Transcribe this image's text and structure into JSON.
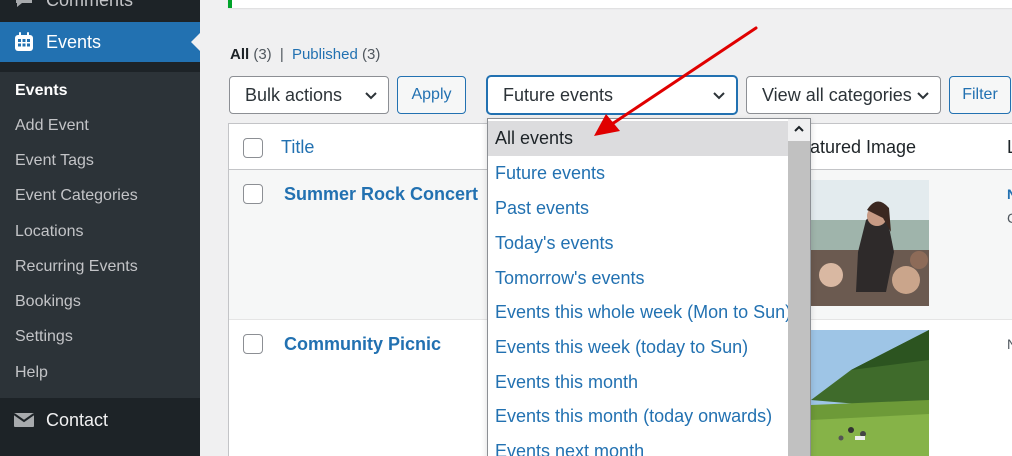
{
  "sidebar": {
    "comments_label": "Comments",
    "events_label": "Events",
    "submenu": [
      {
        "label": "Events",
        "current": true
      },
      {
        "label": "Add Event"
      },
      {
        "label": "Event Tags"
      },
      {
        "label": "Event Categories"
      },
      {
        "label": "Locations"
      },
      {
        "label": "Recurring Events"
      },
      {
        "label": "Bookings"
      },
      {
        "label": "Settings"
      },
      {
        "label": "Help"
      }
    ],
    "contact_label": "Contact"
  },
  "filters": {
    "all_label": "All",
    "all_count": "(3)",
    "separator": "|",
    "published_label": "Published",
    "published_count": "(3)",
    "bulk_actions": "Bulk actions",
    "apply": "Apply",
    "scope_selected": "Future events",
    "category_selected": "View all categories",
    "filter": "Filter"
  },
  "table": {
    "col_title": "Title",
    "col_featured": "Featured Image",
    "col_l": "L",
    "rows": [
      {
        "title": "Summer Rock Concert",
        "side_n": "N",
        "side_c": "C"
      },
      {
        "title": "Community Picnic",
        "side_n": "",
        "side_c": "N"
      }
    ]
  },
  "dropdown": {
    "options": [
      "All events",
      "Future events",
      "Past events",
      "Today's events",
      "Tomorrow's events",
      "Events this whole week (Mon to Sun)",
      "Events this week (today to Sun)",
      "Events this month",
      "Events this month (today onwards)",
      "Events next month"
    ],
    "hovered_index": 0
  },
  "colors": {
    "sidebar_bg": "#1d2327",
    "accent": "#2271b1",
    "annotation_arrow": "#e00000"
  }
}
